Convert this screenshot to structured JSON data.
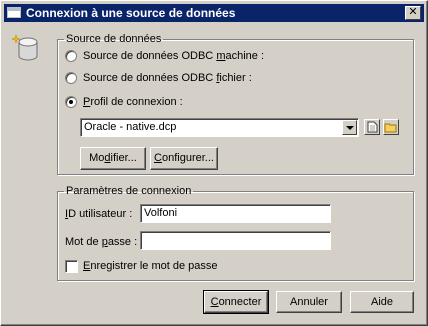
{
  "dialog": {
    "title": "Connexion à une source de données",
    "close_glyph": "✕"
  },
  "source_group": {
    "legend": "Source de données",
    "radio_odbc_machine": {
      "pre": "Source de données ODBC ",
      "mnemonic": "m",
      "post": "achine :"
    },
    "radio_odbc_file": {
      "pre": "Source de données ODBC ",
      "mnemonic": "f",
      "post": "ichier :"
    },
    "radio_profile": {
      "pre": "",
      "mnemonic": "P",
      "post": "rofil de connexion :"
    },
    "profile_value": "Oracle - native.dcp",
    "modify": {
      "pre": "Mo",
      "mnemonic": "d",
      "post": "ifier..."
    },
    "configure": {
      "pre": "",
      "mnemonic": "C",
      "post": "onfigurer..."
    }
  },
  "params_group": {
    "legend": "Paramètres de connexion",
    "user_label": {
      "pre": "",
      "mnemonic": "I",
      "post": "D utilisateur :"
    },
    "user_value": "Volfoni",
    "password_label": {
      "pre": "Mot de ",
      "mnemonic": "p",
      "post": "asse :"
    },
    "password_value": "",
    "remember": {
      "pre": "",
      "mnemonic": "E",
      "post": "nregistrer le mot de passe"
    }
  },
  "buttons": {
    "connect": {
      "pre": "",
      "mnemonic": "C",
      "post": "onnecter"
    },
    "cancel": "Annuler",
    "help": "Aide"
  },
  "icons": [
    "database-icon",
    "new-document-icon",
    "folder-icon",
    "window-icon",
    "close-icon",
    "dropdown-arrow-icon"
  ]
}
